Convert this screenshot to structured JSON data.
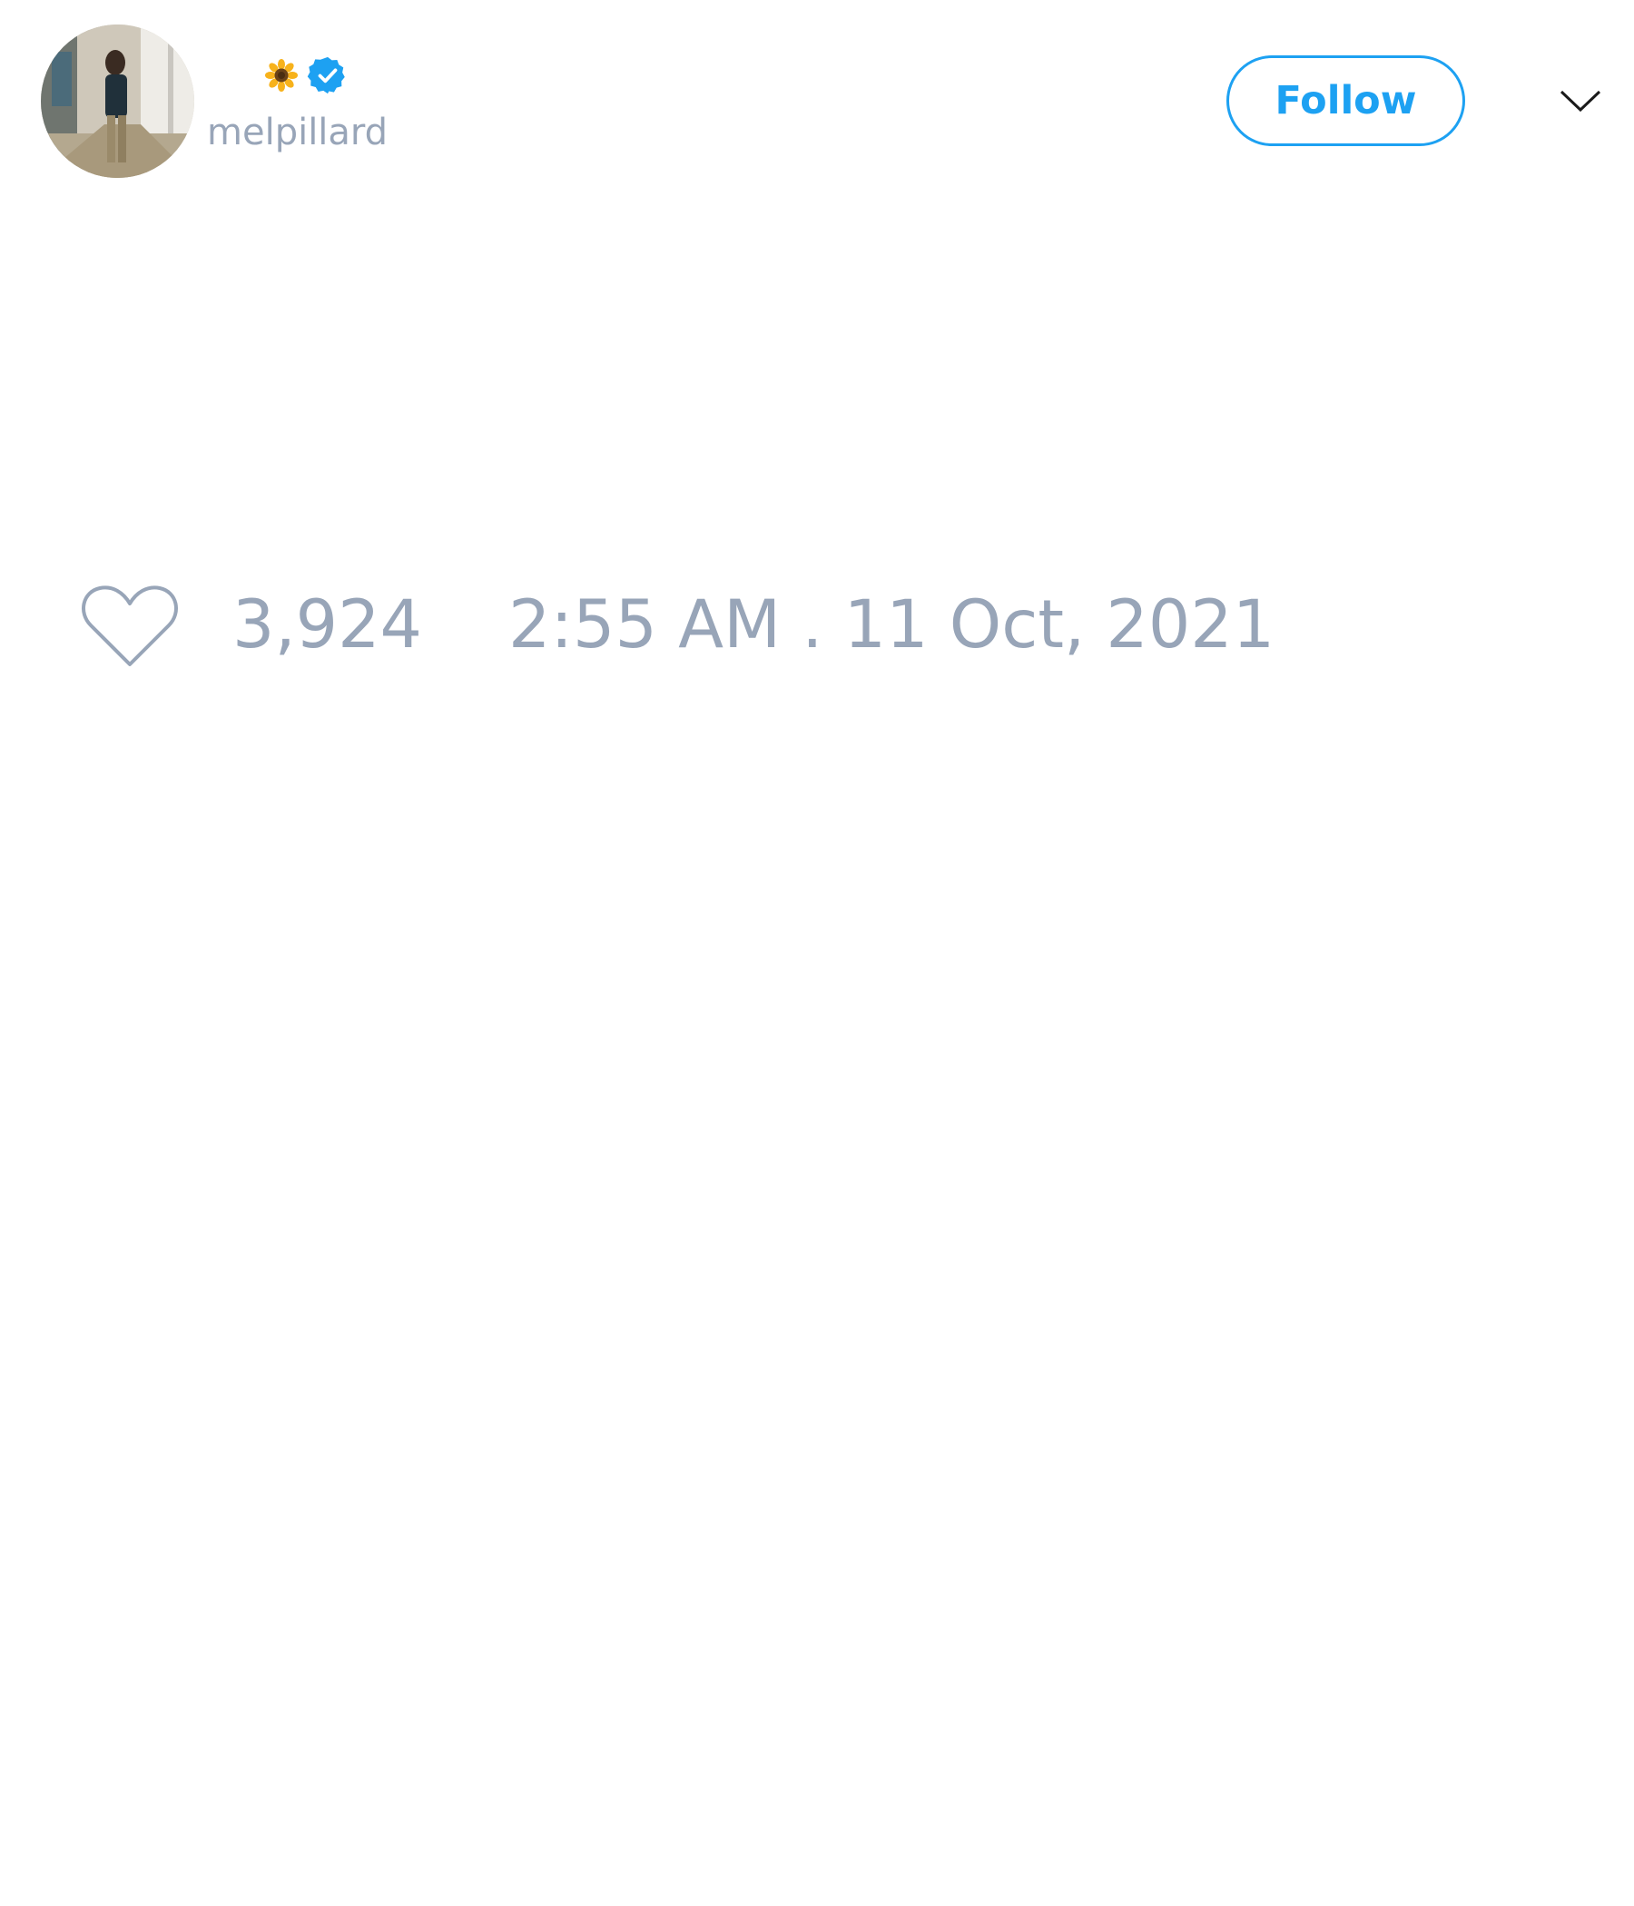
{
  "tweet": {
    "author": {
      "name_emoji_icon": "sunflower-icon",
      "verified_icon": "verified-badge-icon",
      "handle": "melpillard",
      "avatar_icon": "profile-photo"
    },
    "follow_label": "Follow",
    "menu_icon": "chevron-down-icon",
    "like_icon": "heart-icon",
    "like_count": "3,924",
    "timestamp": "2:55 AM . 11 Oct, 2021"
  },
  "colors": {
    "accent": "#1da1f2",
    "muted_text": "#98a5b8",
    "background": "#ffffff"
  }
}
